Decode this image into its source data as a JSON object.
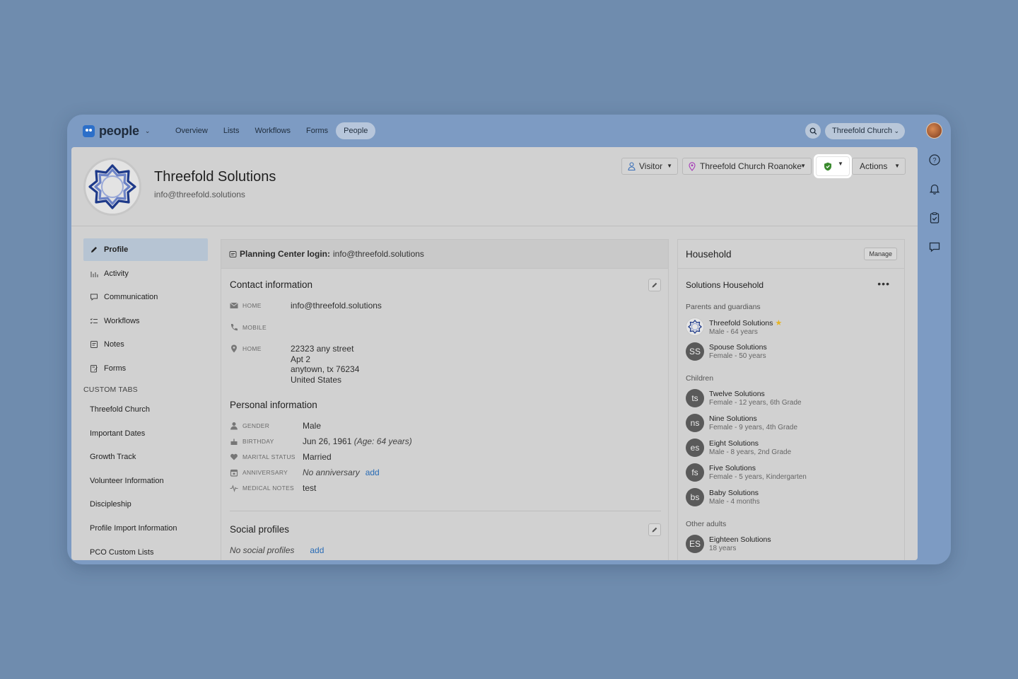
{
  "app": {
    "name": "people",
    "nav": [
      "Overview",
      "Lists",
      "Workflows",
      "Forms",
      "People"
    ],
    "active_nav": "People",
    "org": "Threefold Church"
  },
  "person": {
    "name": "Threefold Solutions",
    "email": "info@threefold.solutions"
  },
  "header_buttons": {
    "status": "Visitor",
    "campus": "Threefold Church Roanoke",
    "actions": "Actions"
  },
  "sidebar": {
    "items": [
      {
        "label": "Profile",
        "icon": "pencil-icon"
      },
      {
        "label": "Activity",
        "icon": "activity-icon"
      },
      {
        "label": "Communication",
        "icon": "chat-icon"
      },
      {
        "label": "Workflows",
        "icon": "list-check-icon"
      },
      {
        "label": "Notes",
        "icon": "notes-icon"
      },
      {
        "label": "Forms",
        "icon": "forms-icon"
      }
    ],
    "custom_tabs_heading": "CUSTOM TABS",
    "custom_tabs": [
      "Threefold Church",
      "Important Dates",
      "Growth Track",
      "Volunteer Information",
      "Discipleship",
      "Profile Import Information",
      "PCO Custom Lists"
    ]
  },
  "login": {
    "label": "Planning Center login:",
    "value": "info@threefold.solutions"
  },
  "contact": {
    "title": "Contact information",
    "email_label": "HOME",
    "email": "info@threefold.solutions",
    "phone_label": "MOBILE",
    "address_label": "HOME",
    "address_lines": [
      "22323 any street",
      "Apt 2",
      "anytown, tx 76234",
      "United States"
    ]
  },
  "personal": {
    "title": "Personal information",
    "gender_label": "GENDER",
    "gender": "Male",
    "birthday_label": "BIRTHDAY",
    "birthday": "Jun 26, 1961",
    "age": "(Age: 64 years)",
    "marital_label": "MARITAL STATUS",
    "marital": "Married",
    "anniversary_label": "ANNIVERSARY",
    "anniversary": "No anniversary",
    "anniversary_add": "add",
    "medical_label": "MEDICAL NOTES",
    "medical": "test"
  },
  "social": {
    "title": "Social profiles",
    "empty": "No social profiles",
    "add": "add"
  },
  "household": {
    "title": "Household",
    "manage": "Manage",
    "name": "Solutions Household",
    "more": "•••",
    "parents_label": "Parents and guardians",
    "parents": [
      {
        "initials": "",
        "name": "Threefold Solutions",
        "sub": "Male - 64 years",
        "primary": true
      },
      {
        "initials": "SS",
        "name": "Spouse Solutions",
        "sub": "Female - 50 years",
        "primary": false
      }
    ],
    "children_label": "Children",
    "children": [
      {
        "initials": "ts",
        "name": "Twelve Solutions",
        "sub": "Female - 12 years, 6th Grade"
      },
      {
        "initials": "ns",
        "name": "Nine Solutions",
        "sub": "Female - 9 years, 4th Grade"
      },
      {
        "initials": "es",
        "name": "Eight Solutions",
        "sub": "Male - 8 years, 2nd Grade"
      },
      {
        "initials": "fs",
        "name": "Five Solutions",
        "sub": "Female - 5 years, Kindergarten"
      },
      {
        "initials": "bs",
        "name": "Baby Solutions",
        "sub": "Male - 4 months"
      }
    ],
    "others_label": "Other adults",
    "others": [
      {
        "initials": "ES",
        "name": "Eighteen Solutions",
        "sub": "18 years"
      }
    ]
  },
  "colors": {
    "background": "#6f8cae",
    "content": "#d1d1d1",
    "accent": "#2a6cb5",
    "active_item": "#b6c4d3",
    "shield": "#3a8a2e"
  }
}
